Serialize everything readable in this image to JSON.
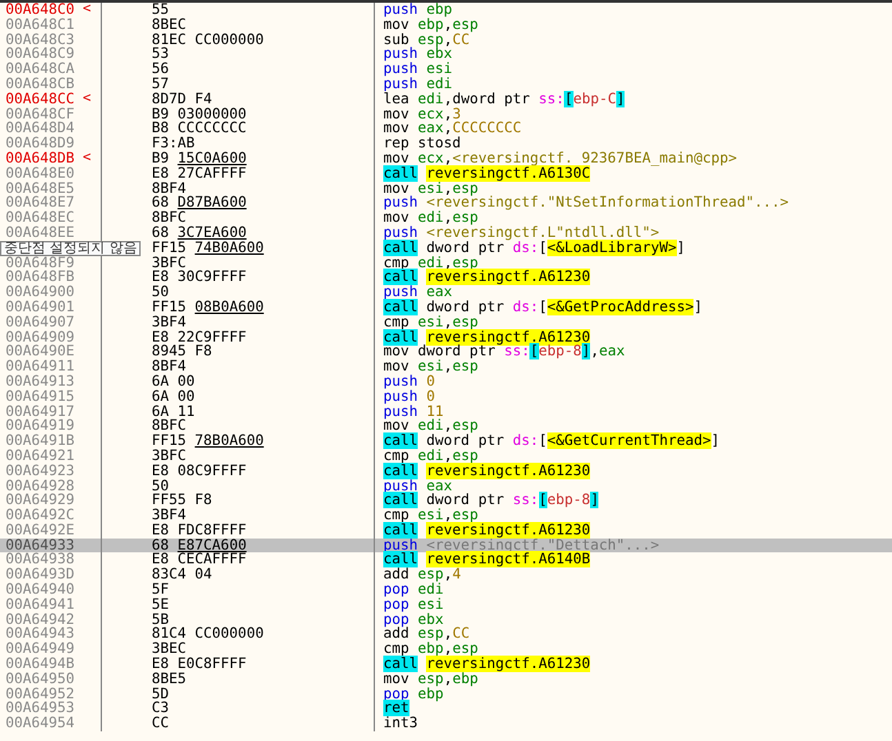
{
  "rows": [
    {
      "address": "00A648C0",
      "breakpoint": true,
      "mark": "<",
      "bytes": "55",
      "instruction": [
        {
          "text": "push ",
          "kind": "stack"
        },
        {
          "text": "ebp",
          "kind": "reg"
        }
      ]
    },
    {
      "address": "00A648C1",
      "breakpoint": false,
      "bytes": "8BEC",
      "instruction": [
        {
          "text": "mov ",
          "kind": "op"
        },
        {
          "text": "ebp",
          "kind": "reg"
        },
        {
          "text": ",",
          "kind": "op"
        },
        {
          "text": "esp",
          "kind": "reg"
        }
      ]
    },
    {
      "address": "00A648C3",
      "breakpoint": false,
      "bytes": "81EC CC000000",
      "instruction": [
        {
          "text": "sub ",
          "kind": "op"
        },
        {
          "text": "esp",
          "kind": "reg"
        },
        {
          "text": ",",
          "kind": "op"
        },
        {
          "text": "CC",
          "kind": "num"
        }
      ]
    },
    {
      "address": "00A648C9",
      "breakpoint": false,
      "bytes": "53",
      "instruction": [
        {
          "text": "push ",
          "kind": "stack"
        },
        {
          "text": "ebx",
          "kind": "reg"
        }
      ]
    },
    {
      "address": "00A648CA",
      "breakpoint": false,
      "bytes": "56",
      "instruction": [
        {
          "text": "push ",
          "kind": "stack"
        },
        {
          "text": "esi",
          "kind": "reg"
        }
      ]
    },
    {
      "address": "00A648CB",
      "breakpoint": false,
      "bytes": "57",
      "instruction": [
        {
          "text": "push ",
          "kind": "stack"
        },
        {
          "text": "edi",
          "kind": "reg"
        }
      ]
    },
    {
      "address": "00A648CC",
      "breakpoint": true,
      "mark": "<",
      "bytes": "8D7D F4",
      "instruction": [
        {
          "text": "lea ",
          "kind": "op"
        },
        {
          "text": "edi",
          "kind": "reg"
        },
        {
          "text": ",dword ptr ",
          "kind": "op"
        },
        {
          "text": "ss:",
          "kind": "seg"
        },
        {
          "text": "[",
          "kind": "bracket"
        },
        {
          "text": "ebp-C",
          "kind": "mem"
        },
        {
          "text": "]",
          "kind": "bracket"
        }
      ]
    },
    {
      "address": "00A648CF",
      "breakpoint": false,
      "bytes": "B9 03000000",
      "instruction": [
        {
          "text": "mov ",
          "kind": "op"
        },
        {
          "text": "ecx",
          "kind": "reg"
        },
        {
          "text": ",",
          "kind": "op"
        },
        {
          "text": "3",
          "kind": "num"
        }
      ]
    },
    {
      "address": "00A648D4",
      "breakpoint": false,
      "bytes": "B8 CCCCCCCC",
      "instruction": [
        {
          "text": "mov ",
          "kind": "op"
        },
        {
          "text": "eax",
          "kind": "reg"
        },
        {
          "text": ",",
          "kind": "op"
        },
        {
          "text": "CCCCCCCC",
          "kind": "num"
        }
      ]
    },
    {
      "address": "00A648D9",
      "breakpoint": false,
      "bytes": "F3:AB",
      "instruction": [
        {
          "text": "rep stosd",
          "kind": "op"
        }
      ]
    },
    {
      "address": "00A648DB",
      "breakpoint": true,
      "mark": "<",
      "bytes": "B9",
      "bytes_ref": "15C0A600",
      "instruction": [
        {
          "text": "mov ",
          "kind": "op"
        },
        {
          "text": "ecx",
          "kind": "reg"
        },
        {
          "text": ",",
          "kind": "op"
        },
        {
          "text": "<reversingctf._92367BEA_main@cpp>",
          "kind": "sym"
        }
      ]
    },
    {
      "address": "00A648E0",
      "breakpoint": false,
      "bytes": "E8 27CAFFFF",
      "instruction": [
        {
          "text": "call",
          "kind": "flow"
        },
        {
          "text": "reversingctf.A6130C",
          "kind": "target"
        }
      ]
    },
    {
      "address": "00A648E5",
      "breakpoint": false,
      "bytes": "8BF4",
      "instruction": [
        {
          "text": "mov ",
          "kind": "op"
        },
        {
          "text": "esi",
          "kind": "reg"
        },
        {
          "text": ",",
          "kind": "op"
        },
        {
          "text": "esp",
          "kind": "reg"
        }
      ]
    },
    {
      "address": "00A648E7",
      "breakpoint": false,
      "bytes": "68",
      "bytes_ref": "D87BA600",
      "instruction": [
        {
          "text": "push ",
          "kind": "stack"
        },
        {
          "text": "<reversingctf.\"NtSetInformationThread\"...>",
          "kind": "sym"
        }
      ]
    },
    {
      "address": "00A648EC",
      "breakpoint": false,
      "bytes": "8BFC",
      "instruction": [
        {
          "text": "mov ",
          "kind": "op"
        },
        {
          "text": "edi",
          "kind": "reg"
        },
        {
          "text": ",",
          "kind": "op"
        },
        {
          "text": "esp",
          "kind": "reg"
        }
      ]
    },
    {
      "address": "00A648EE",
      "breakpoint": false,
      "bytes": "68",
      "bytes_ref": "3C7EA600",
      "instruction": [
        {
          "text": "push ",
          "kind": "stack"
        },
        {
          "text": "<reversingctf.L\"ntdll.dll\">",
          "kind": "sym"
        }
      ]
    },
    {
      "bytes": "FF15",
      "bytes_ref": "74B0A600",
      "instruction": [
        {
          "text": "call",
          "kind": "flow"
        },
        {
          "text": " dword ptr ",
          "kind": "op"
        },
        {
          "text": "ds:",
          "kind": "seg"
        },
        {
          "text": "[",
          "kind": "op"
        },
        {
          "text": "<&LoadLibraryW>",
          "kind": "target"
        },
        {
          "text": "]",
          "kind": "op"
        }
      ]
    },
    {
      "address": "00A648F9",
      "breakpoint": false,
      "bytes": "3BFC",
      "instruction": [
        {
          "text": "cmp ",
          "kind": "op"
        },
        {
          "text": "edi",
          "kind": "reg"
        },
        {
          "text": ",",
          "kind": "op"
        },
        {
          "text": "esp",
          "kind": "reg"
        }
      ]
    },
    {
      "address": "00A648FB",
      "breakpoint": false,
      "bytes": "E8 30C9FFFF",
      "instruction": [
        {
          "text": "call",
          "kind": "flow"
        },
        {
          "text": "reversingctf.A61230",
          "kind": "target"
        }
      ]
    },
    {
      "address": "00A64900",
      "breakpoint": false,
      "bytes": "50",
      "instruction": [
        {
          "text": "push ",
          "kind": "stack"
        },
        {
          "text": "eax",
          "kind": "reg"
        }
      ]
    },
    {
      "address": "00A64901",
      "breakpoint": false,
      "bytes": "FF15",
      "bytes_ref": "08B0A600",
      "instruction": [
        {
          "text": "call",
          "kind": "flow"
        },
        {
          "text": " dword ptr ",
          "kind": "op"
        },
        {
          "text": "ds:",
          "kind": "seg"
        },
        {
          "text": "[",
          "kind": "op"
        },
        {
          "text": "<&GetProcAddress>",
          "kind": "target"
        },
        {
          "text": "]",
          "kind": "op"
        }
      ]
    },
    {
      "address": "00A64907",
      "breakpoint": false,
      "bytes": "3BF4",
      "instruction": [
        {
          "text": "cmp ",
          "kind": "op"
        },
        {
          "text": "esi",
          "kind": "reg"
        },
        {
          "text": ",",
          "kind": "op"
        },
        {
          "text": "esp",
          "kind": "reg"
        }
      ]
    },
    {
      "address": "00A64909",
      "breakpoint": false,
      "bytes": "E8 22C9FFFF",
      "instruction": [
        {
          "text": "call",
          "kind": "flow"
        },
        {
          "text": "reversingctf.A61230",
          "kind": "target"
        }
      ]
    },
    {
      "address": "00A6490E",
      "breakpoint": false,
      "bytes": "8945 F8",
      "instruction": [
        {
          "text": "mov dword ptr ",
          "kind": "op"
        },
        {
          "text": "ss:",
          "kind": "seg"
        },
        {
          "text": "[",
          "kind": "bracket"
        },
        {
          "text": "ebp-8",
          "kind": "mem"
        },
        {
          "text": "]",
          "kind": "bracket"
        },
        {
          "text": ",",
          "kind": "op"
        },
        {
          "text": "eax",
          "kind": "reg"
        }
      ]
    },
    {
      "address": "00A64911",
      "breakpoint": false,
      "bytes": "8BF4",
      "instruction": [
        {
          "text": "mov ",
          "kind": "op"
        },
        {
          "text": "esi",
          "kind": "reg"
        },
        {
          "text": ",",
          "kind": "op"
        },
        {
          "text": "esp",
          "kind": "reg"
        }
      ]
    },
    {
      "address": "00A64913",
      "breakpoint": false,
      "bytes": "6A 00",
      "instruction": [
        {
          "text": "push ",
          "kind": "stack"
        },
        {
          "text": "0",
          "kind": "num"
        }
      ]
    },
    {
      "address": "00A64915",
      "breakpoint": false,
      "bytes": "6A 00",
      "instruction": [
        {
          "text": "push ",
          "kind": "stack"
        },
        {
          "text": "0",
          "kind": "num"
        }
      ]
    },
    {
      "address": "00A64917",
      "breakpoint": false,
      "bytes": "6A 11",
      "instruction": [
        {
          "text": "push ",
          "kind": "stack"
        },
        {
          "text": "11",
          "kind": "num"
        }
      ]
    },
    {
      "address": "00A64919",
      "breakpoint": false,
      "bytes": "8BFC",
      "instruction": [
        {
          "text": "mov ",
          "kind": "op"
        },
        {
          "text": "edi",
          "kind": "reg"
        },
        {
          "text": ",",
          "kind": "op"
        },
        {
          "text": "esp",
          "kind": "reg"
        }
      ]
    },
    {
      "address": "00A6491B",
      "breakpoint": false,
      "bytes": "FF15",
      "bytes_ref": "78B0A600",
      "instruction": [
        {
          "text": "call",
          "kind": "flow"
        },
        {
          "text": " dword ptr ",
          "kind": "op"
        },
        {
          "text": "ds:",
          "kind": "seg"
        },
        {
          "text": "[",
          "kind": "op"
        },
        {
          "text": "<&GetCurrentThread>",
          "kind": "target"
        },
        {
          "text": "]",
          "kind": "op"
        }
      ]
    },
    {
      "address": "00A64921",
      "breakpoint": false,
      "bytes": "3BFC",
      "instruction": [
        {
          "text": "cmp ",
          "kind": "op"
        },
        {
          "text": "edi",
          "kind": "reg"
        },
        {
          "text": ",",
          "kind": "op"
        },
        {
          "text": "esp",
          "kind": "reg"
        }
      ]
    },
    {
      "address": "00A64923",
      "breakpoint": false,
      "bytes": "E8 08C9FFFF",
      "instruction": [
        {
          "text": "call",
          "kind": "flow"
        },
        {
          "text": "reversingctf.A61230",
          "kind": "target"
        }
      ]
    },
    {
      "address": "00A64928",
      "breakpoint": false,
      "bytes": "50",
      "instruction": [
        {
          "text": "push ",
          "kind": "stack"
        },
        {
          "text": "eax",
          "kind": "reg"
        }
      ]
    },
    {
      "address": "00A64929",
      "breakpoint": false,
      "bytes": "FF55 F8",
      "instruction": [
        {
          "text": "call",
          "kind": "flow"
        },
        {
          "text": " dword ptr ",
          "kind": "op"
        },
        {
          "text": "ss:",
          "kind": "seg"
        },
        {
          "text": "[",
          "kind": "bracket"
        },
        {
          "text": "ebp-8",
          "kind": "mem"
        },
        {
          "text": "]",
          "kind": "bracket"
        }
      ]
    },
    {
      "address": "00A6492C",
      "breakpoint": false,
      "bytes": "3BF4",
      "instruction": [
        {
          "text": "cmp ",
          "kind": "op"
        },
        {
          "text": "esi",
          "kind": "reg"
        },
        {
          "text": ",",
          "kind": "op"
        },
        {
          "text": "esp",
          "kind": "reg"
        }
      ]
    },
    {
      "address": "00A6492E",
      "breakpoint": false,
      "bytes": "E8 FDC8FFFF",
      "instruction": [
        {
          "text": "call",
          "kind": "flow"
        },
        {
          "text": "reversingctf.A61230",
          "kind": "target"
        }
      ]
    },
    {
      "address": "00A64933",
      "breakpoint": false,
      "selected": true,
      "bytes": "68",
      "bytes_ref": "E87CA600",
      "instruction": [
        {
          "text": "push ",
          "kind": "stack"
        },
        {
          "text": "<reversingctf.\"Dettach\"...>",
          "kind": "sym"
        }
      ]
    },
    {
      "address": "00A64938",
      "breakpoint": false,
      "bytes": "E8 CECAFFFF",
      "instruction": [
        {
          "text": "call",
          "kind": "flow"
        },
        {
          "text": "reversingctf.A6140B",
          "kind": "target"
        }
      ]
    },
    {
      "address": "00A6493D",
      "breakpoint": false,
      "bytes": "83C4 04",
      "instruction": [
        {
          "text": "add ",
          "kind": "op"
        },
        {
          "text": "esp",
          "kind": "reg"
        },
        {
          "text": ",",
          "kind": "op"
        },
        {
          "text": "4",
          "kind": "num"
        }
      ]
    },
    {
      "address": "00A64940",
      "breakpoint": false,
      "bytes": "5F",
      "instruction": [
        {
          "text": "pop ",
          "kind": "stack"
        },
        {
          "text": "edi",
          "kind": "reg"
        }
      ]
    },
    {
      "address": "00A64941",
      "breakpoint": false,
      "bytes": "5E",
      "instruction": [
        {
          "text": "pop ",
          "kind": "stack"
        },
        {
          "text": "esi",
          "kind": "reg"
        }
      ]
    },
    {
      "address": "00A64942",
      "breakpoint": false,
      "bytes": "5B",
      "instruction": [
        {
          "text": "pop ",
          "kind": "stack"
        },
        {
          "text": "ebx",
          "kind": "reg"
        }
      ]
    },
    {
      "address": "00A64943",
      "breakpoint": false,
      "bytes": "81C4 CC000000",
      "instruction": [
        {
          "text": "add ",
          "kind": "op"
        },
        {
          "text": "esp",
          "kind": "reg"
        },
        {
          "text": ",",
          "kind": "op"
        },
        {
          "text": "CC",
          "kind": "num"
        }
      ]
    },
    {
      "address": "00A64949",
      "breakpoint": false,
      "bytes": "3BEC",
      "instruction": [
        {
          "text": "cmp ",
          "kind": "op"
        },
        {
          "text": "ebp",
          "kind": "reg"
        },
        {
          "text": ",",
          "kind": "op"
        },
        {
          "text": "esp",
          "kind": "reg"
        }
      ]
    },
    {
      "address": "00A6494B",
      "breakpoint": false,
      "bytes": "E8 E0C8FFFF",
      "instruction": [
        {
          "text": "call",
          "kind": "flow"
        },
        {
          "text": "reversingctf.A61230",
          "kind": "target"
        }
      ]
    },
    {
      "address": "00A64950",
      "breakpoint": false,
      "bytes": "8BE5",
      "instruction": [
        {
          "text": "mov ",
          "kind": "op"
        },
        {
          "text": "esp",
          "kind": "reg"
        },
        {
          "text": ",",
          "kind": "op"
        },
        {
          "text": "ebp",
          "kind": "reg"
        }
      ]
    },
    {
      "address": "00A64952",
      "breakpoint": false,
      "bytes": "5D",
      "instruction": [
        {
          "text": "pop ",
          "kind": "stack"
        },
        {
          "text": "ebp",
          "kind": "reg"
        }
      ]
    },
    {
      "address": "00A64953",
      "breakpoint": false,
      "bytes": "C3",
      "instruction": [
        {
          "text": "ret",
          "kind": "flow"
        }
      ]
    },
    {
      "address": "00A64954",
      "breakpoint": false,
      "bytes": "CC",
      "instruction": [
        {
          "text": "int3",
          "kind": "op"
        }
      ]
    }
  ],
  "tooltip": {
    "text": "중단점 설정되지 않음"
  }
}
